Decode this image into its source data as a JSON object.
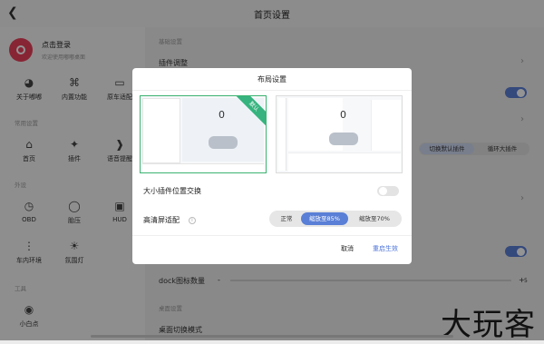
{
  "header": {
    "title": "首页设置",
    "back_icon": "chevron-left-icon"
  },
  "profile": {
    "title": "点击登录",
    "subtitle": "欢迎使用嘟嘟桌面"
  },
  "sidebar": {
    "top_items": [
      {
        "label": "关于嘟嘟",
        "icon": "logo-icon"
      },
      {
        "label": "内置功能",
        "icon": "apps-icon"
      },
      {
        "label": "原车适配",
        "icon": "car-icon"
      }
    ],
    "sections": [
      {
        "title": "常用设置",
        "items": [
          {
            "label": "首页",
            "icon": "home-icon"
          },
          {
            "label": "插件",
            "icon": "puzzle-icon"
          },
          {
            "label": "语音提醒",
            "icon": "voice-icon"
          }
        ]
      },
      {
        "title": "外设",
        "items": [
          {
            "label": "OBD",
            "icon": "obd-icon"
          },
          {
            "label": "胎压",
            "icon": "tire-icon"
          },
          {
            "label": "HUD",
            "icon": "hud-icon"
          }
        ]
      },
      {
        "title": "",
        "items": [
          {
            "label": "车内环境",
            "icon": "thermometer-icon"
          },
          {
            "label": "氛围灯",
            "icon": "ambient-light-icon"
          }
        ]
      },
      {
        "title": "工具",
        "items": [
          {
            "label": "小白点",
            "icon": "dot-icon"
          }
        ]
      }
    ]
  },
  "content": {
    "section_basic": "基础设置",
    "plugin_adjust": "插件调整",
    "tab_default": "切换默认插件",
    "tab_loop": "循环大插件",
    "dock_label": "dock图标数量",
    "dock_minus": "-",
    "dock_plus": "+",
    "dock_value": "5",
    "section_desktop": "桌面设置",
    "desktop_switch_mode": "桌面切换模式"
  },
  "modal": {
    "title": "布局设置",
    "default_badge": "默认",
    "preview_value": "0",
    "swap_label": "大小插件位置交换",
    "hd_label": "高清屏适配",
    "scale_options": [
      "正常",
      "缩放至85%",
      "缩放至70%"
    ],
    "scale_selected": "缩放至85%",
    "cancel": "取消",
    "restart": "重启生效"
  },
  "watermark": "大玩客",
  "colors": {
    "accent": "#5a7fd6",
    "logo": "#e8415a",
    "badge": "#36b37e"
  }
}
